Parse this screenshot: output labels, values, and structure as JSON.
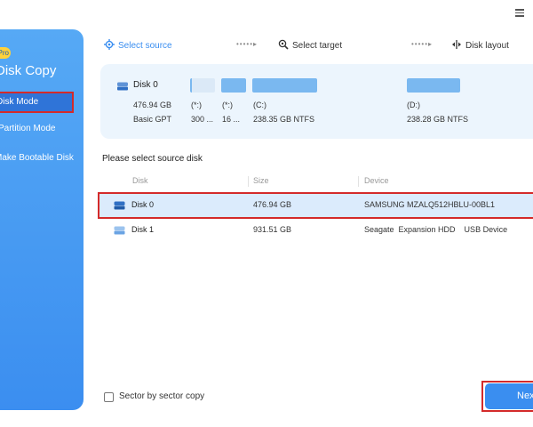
{
  "app": {
    "badge": "Pro",
    "name": "Disk Copy",
    "menu_icon": "hamburger-menu-icon"
  },
  "sidebar": {
    "items": [
      {
        "label": "Disk Mode",
        "active": true
      },
      {
        "label": "Partition Mode",
        "active": false
      },
      {
        "label": "Make Bootable Disk",
        "active": false
      }
    ]
  },
  "steps": [
    {
      "label": "Select source",
      "icon": "target-icon",
      "active": true
    },
    {
      "label": "Select target",
      "icon": "search-target-icon",
      "active": false
    },
    {
      "label": "Disk layout",
      "icon": "layout-split-icon",
      "active": false
    }
  ],
  "disk_panel": {
    "name": "Disk 0",
    "size": "476.94 GB",
    "type": "Basic GPT",
    "partitions": [
      {
        "letter": "(*:)",
        "size": "300 ..."
      },
      {
        "letter": "(*:)",
        "size": "16 ..."
      },
      {
        "letter": "(C:)",
        "size": "238.35 GB NTFS"
      },
      {
        "letter": "(D:)",
        "size": "238.28 GB NTFS"
      }
    ]
  },
  "source": {
    "title": "Please select source disk",
    "columns": [
      "Disk",
      "Size",
      "Device"
    ],
    "rows": [
      {
        "disk": "Disk 0",
        "size": "476.94 GB",
        "device": "SAMSUNG MZALQ512HBLU-00BL1",
        "selected": true
      },
      {
        "disk": "Disk 1",
        "size": "931.51 GB",
        "device": "Seagate  Expansion HDD    USB Device",
        "selected": false
      }
    ]
  },
  "footer": {
    "sector_label": "Sector by sector copy",
    "sector_checked": false,
    "next_label": "Next"
  },
  "colors": {
    "accent": "#3a8ef0",
    "sidebar_active": "#2f74d8",
    "highlight_border": "#d42a2a",
    "selected_row": "#dbebfc",
    "panel_bg": "#ecf5fd"
  }
}
